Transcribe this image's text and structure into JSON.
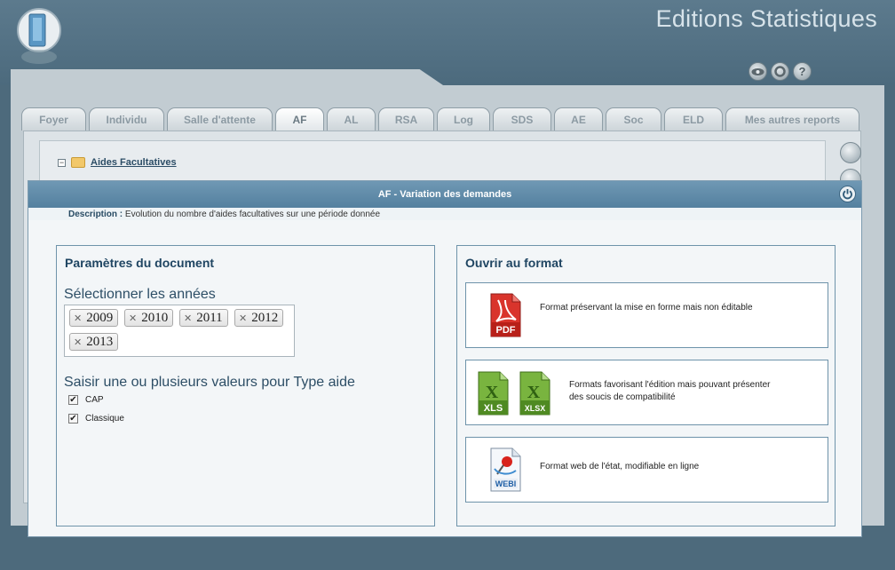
{
  "app": {
    "title": "Editions Statistiques"
  },
  "tabs": [
    {
      "label": "Foyer",
      "active": false
    },
    {
      "label": "Individu",
      "active": false
    },
    {
      "label": "Salle d'attente",
      "active": false
    },
    {
      "label": "AF",
      "active": true
    },
    {
      "label": "AL",
      "active": false
    },
    {
      "label": "RSA",
      "active": false
    },
    {
      "label": "Log",
      "active": false
    },
    {
      "label": "SDS",
      "active": false
    },
    {
      "label": "AE",
      "active": false
    },
    {
      "label": "Soc",
      "active": false
    },
    {
      "label": "ELD",
      "active": false
    },
    {
      "label": "Mes autres reports",
      "active": false
    }
  ],
  "tree": {
    "folder_label": "Aides Facultatives"
  },
  "modal": {
    "title": "AF - Variation des demandes",
    "description_label": "Description :",
    "description_text": "Evolution du nombre d'aides facultatives sur une période donnée",
    "params": {
      "title": "Paramètres du document",
      "years_label": "Sélectionner les années",
      "years": [
        "2009",
        "2010",
        "2011",
        "2012",
        "2013"
      ],
      "type_label": "Saisir une ou plusieurs valeurs pour Type aide",
      "type_options": [
        {
          "label": "CAP",
          "checked": true
        },
        {
          "label": "Classique",
          "checked": true
        }
      ]
    },
    "formats": {
      "title": "Ouvrir au format",
      "pdf": {
        "icon_text": "PDF",
        "description": "Format préservant la mise en forme mais non éditable"
      },
      "excel": {
        "xls_text": "XLS",
        "xlsx_text": "XLSX",
        "description_line1": "Formats favorisant l'édition mais pouvant présenter",
        "description_line2": "des soucis de compatibilité"
      },
      "webi": {
        "icon_text": "WEBI",
        "description": "Format web de l'état, modifiable en ligne"
      }
    }
  },
  "colors": {
    "header_band": "#4c6a7d",
    "modal_header": "#5f8aa8",
    "box_border": "#6e93aa",
    "title_text": "#1f4562",
    "pdf_red": "#c72a24",
    "excel_green": "#5f9a2d"
  }
}
